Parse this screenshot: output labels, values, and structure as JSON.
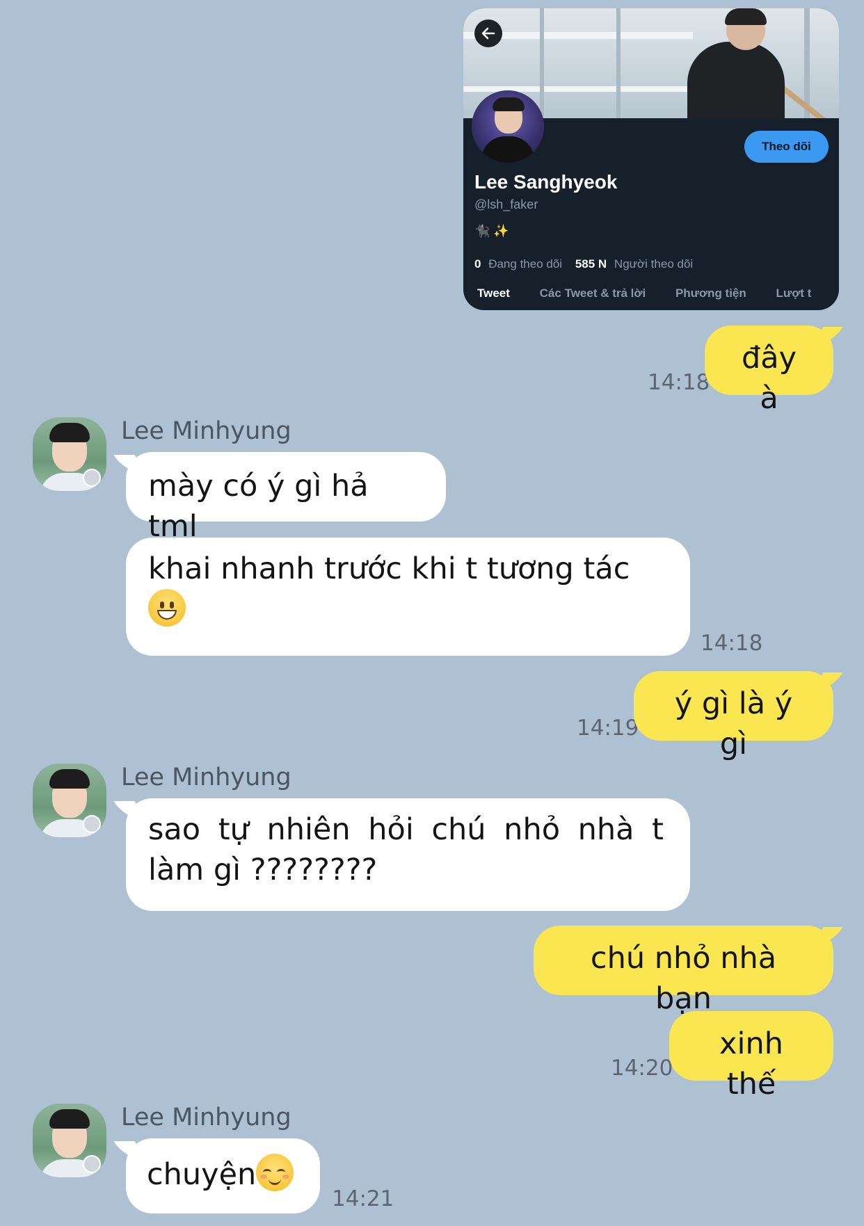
{
  "profile_card": {
    "name": "Lee Sanghyeok",
    "handle": "@lsh_faker",
    "bio_emoji": "🐈‍⬛ ✨",
    "follow_label": "Theo dõi",
    "following_count": "0",
    "following_label": "Đang theo dõi",
    "followers_count": "585 N",
    "followers_label": "Người theo dõi",
    "tabs": [
      "Tweet",
      "Các Tweet & trả lời",
      "Phương tiện",
      "Lượt t"
    ],
    "icons": {
      "back": "arrow-left-icon"
    }
  },
  "messages": [
    {
      "side": "out",
      "text": "đây à",
      "time": "14:18"
    },
    {
      "side": "in",
      "sender": "Lee Minhyung",
      "text": "mày có ý gì hả tml"
    },
    {
      "side": "in",
      "text": "khai nhanh trước khi t tương tác",
      "emoji": "grinning-face",
      "time": "14:18"
    },
    {
      "side": "out",
      "text": "ý gì là ý gì",
      "time": "14:19"
    },
    {
      "side": "in",
      "sender": "Lee Minhyung",
      "text": "sao tự nhiên hỏi chú nhỏ nhà t làm gì ????????"
    },
    {
      "side": "out",
      "text": "chú nhỏ nhà bạn"
    },
    {
      "side": "out",
      "text": "xinh thế",
      "time": "14:20"
    },
    {
      "side": "in",
      "sender": "Lee Minhyung",
      "text": "chuyện",
      "emoji": "relieved-face",
      "time": "14:21"
    }
  ],
  "colors": {
    "background": "#adc1d3",
    "outgoing_bubble": "#f9e650",
    "incoming_bubble": "#ffffff",
    "card_background": "#15202b",
    "follow_button": "#3b9af0"
  }
}
